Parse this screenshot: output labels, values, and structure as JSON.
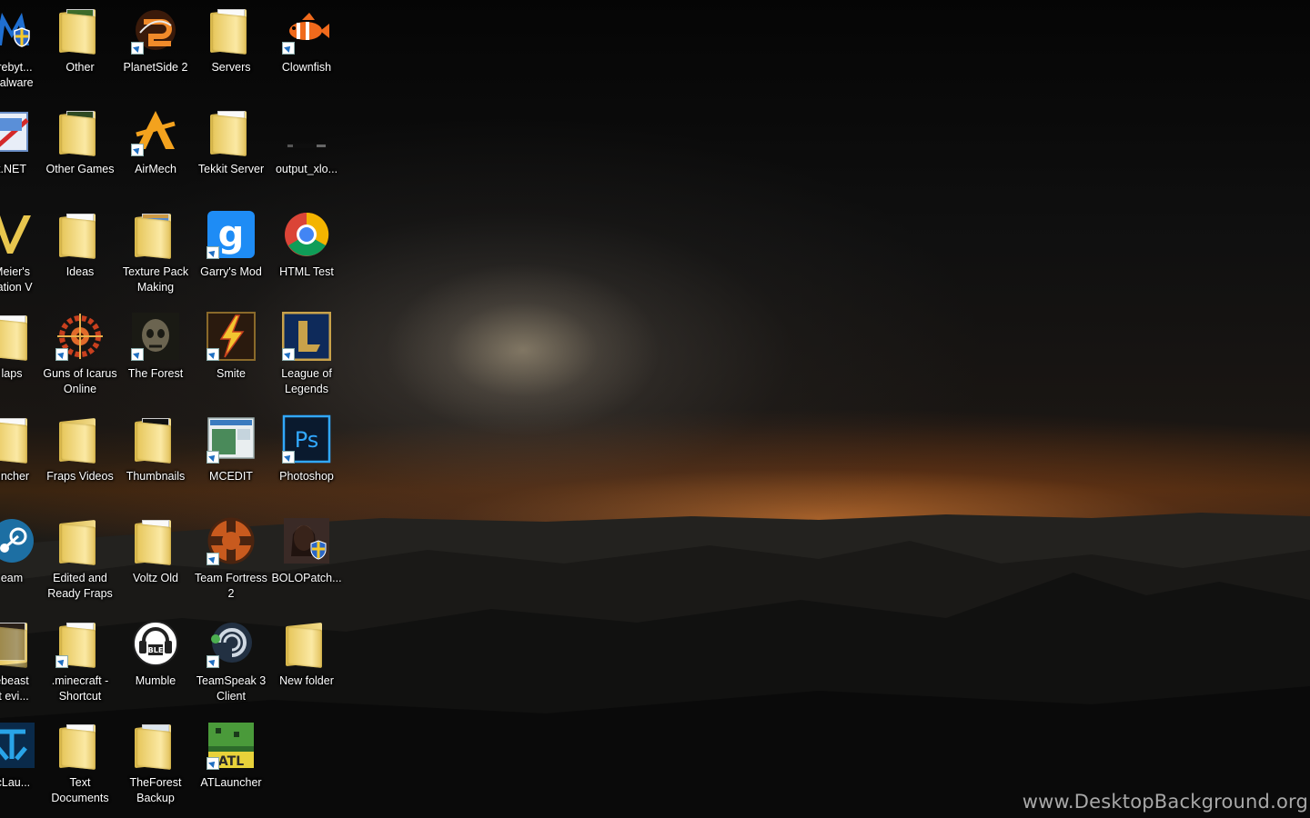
{
  "desktop": {
    "icons": [
      {
        "label": "Malwarebyt... Anti-Malware",
        "short": "arebyt...\nMalware",
        "icon": "malwarebytes-icon",
        "name": "icon-malwarebytes"
      },
      {
        "label": "Other",
        "icon": "folder-icon",
        "name": "icon-other"
      },
      {
        "label": "PlanetSide 2",
        "icon": "planetside-icon",
        "name": "icon-planetside-2"
      },
      {
        "label": "Servers",
        "icon": "folder-icon",
        "name": "icon-servers"
      },
      {
        "label": "Clownfish",
        "icon": "clownfish-icon",
        "name": "icon-clownfish"
      },
      {
        "label": "Paint.NET",
        "short": "t.NET",
        "icon": "paintnet-icon",
        "name": "icon-paintnet"
      },
      {
        "label": "Other Games",
        "icon": "folder-icon",
        "name": "icon-other-games"
      },
      {
        "label": "AirMech",
        "icon": "airmech-icon",
        "name": "icon-airmech"
      },
      {
        "label": "Tekkit Server",
        "icon": "folder-icon",
        "name": "icon-tekkit-server"
      },
      {
        "label": "output_xlo...",
        "icon": "image-file-icon",
        "name": "icon-output-xlo"
      },
      {
        "label": "Sid Meier's Civilization V",
        "short": "Meier's\nzation V",
        "icon": "civ5-icon",
        "name": "icon-civilization-v"
      },
      {
        "label": "Ideas",
        "icon": "folder-icon",
        "name": "icon-ideas"
      },
      {
        "label": "Texture Pack Making",
        "icon": "folder-icon",
        "name": "icon-texture-pack-making"
      },
      {
        "label": "Garry's Mod",
        "icon": "garrys-mod-icon",
        "name": "icon-garrys-mod"
      },
      {
        "label": "HTML Test",
        "icon": "chrome-icon",
        "name": "icon-html-test"
      },
      {
        "label": "Maps",
        "short": "laps",
        "icon": "folder-icon",
        "name": "icon-maps"
      },
      {
        "label": "Guns of Icarus Online",
        "icon": "guns-of-icarus-icon",
        "name": "icon-guns-of-icarus"
      },
      {
        "label": "The Forest",
        "icon": "the-forest-icon",
        "name": "icon-the-forest"
      },
      {
        "label": "Smite",
        "icon": "smite-icon",
        "name": "icon-smite"
      },
      {
        "label": "League of Legends",
        "icon": "league-icon",
        "name": "icon-league-of-legends"
      },
      {
        "label": "Launcher",
        "short": "uncher",
        "icon": "folder-icon",
        "name": "icon-launcher"
      },
      {
        "label": "Fraps Videos",
        "icon": "folder-icon",
        "name": "icon-fraps-videos"
      },
      {
        "label": "Thumbnails",
        "icon": "folder-icon",
        "name": "icon-thumbnails"
      },
      {
        "label": "MCEDIT",
        "icon": "mcedit-icon",
        "name": "icon-mcedit"
      },
      {
        "label": "Photoshop",
        "icon": "photoshop-icon",
        "name": "icon-photoshop"
      },
      {
        "label": "Steam",
        "short": "eam",
        "icon": "steam-icon",
        "name": "icon-steam"
      },
      {
        "label": "Edited and Ready Fraps",
        "icon": "folder-icon",
        "name": "icon-edited-ready-fraps"
      },
      {
        "label": "Voltz Old",
        "icon": "folder-icon",
        "name": "icon-voltz-old"
      },
      {
        "label": "Team Fortress 2",
        "icon": "tf2-icon",
        "name": "icon-team-fortress-2"
      },
      {
        "label": "BOLOPatch...",
        "icon": "bolopatch-icon",
        "name": "icon-bolopatch"
      },
      {
        "label": "Thebeast Short evi...",
        "short": "ebeast\nrt evi...",
        "icon": "folder-icon",
        "name": "icon-thebeast"
      },
      {
        "label": ".minecraft - Shortcut",
        "icon": "folder-icon",
        "name": "icon-minecraft-shortcut"
      },
      {
        "label": "Mumble",
        "icon": "mumble-icon",
        "name": "icon-mumble"
      },
      {
        "label": "TeamSpeak 3 Client",
        "icon": "teamspeak-icon",
        "name": "icon-teamspeak-3"
      },
      {
        "label": "New folder",
        "icon": "folder-icon",
        "name": "icon-new-folder"
      },
      {
        "label": "TechnicLauncher",
        "short": "icLau...",
        "icon": "technic-icon",
        "name": "icon-technic-launcher"
      },
      {
        "label": "Text Documents",
        "icon": "folder-icon",
        "name": "icon-text-documents"
      },
      {
        "label": "TheForest Backup",
        "icon": "folder-icon",
        "name": "icon-theforest-backup"
      },
      {
        "label": "ATLauncher",
        "icon": "atlauncher-icon",
        "name": "icon-atlauncher"
      }
    ]
  },
  "labels": {
    "r0c0": "arebyt...\nMalware",
    "r0c1": "Other",
    "r0c2": "PlanetSide 2",
    "r0c3": "Servers",
    "r0c4": "Clownfish",
    "r1c0": "t.NET",
    "r1c1": "Other Games",
    "r1c2": "AirMech",
    "r1c3": "Tekkit Server",
    "r1c4": "output_xlo...",
    "r2c0": "Meier's\nzation V",
    "r2c1": "Ideas",
    "r2c2": "Texture Pack Making",
    "r2c3": "Garry's Mod",
    "r2c4": "HTML Test",
    "r3c0": "laps",
    "r3c1": "Guns of Icarus Online",
    "r3c2": "The Forest",
    "r3c3": "Smite",
    "r3c4": "League of Legends",
    "r4c0": "uncher",
    "r4c1": "Fraps Videos",
    "r4c2": "Thumbnails",
    "r4c3": "MCEDIT",
    "r4c4": "Photoshop",
    "r5c0": "eam",
    "r5c1": "Edited and Ready Fraps",
    "r5c2": "Voltz Old",
    "r5c3": "Team Fortress 2",
    "r5c4": "BOLOPatch...",
    "r6c0": "ebeast\nrt evi...",
    "r6c1": ".minecraft - Shortcut",
    "r6c2": "Mumble",
    "r6c3": "TeamSpeak 3 Client",
    "r6c4": "New folder",
    "r7c0": "icLau...",
    "r7c1": "Text Documents",
    "r7c2": "TheForest Backup",
    "r7c3": "ATLauncher"
  },
  "watermark": "www.DesktopBackground.org",
  "colors": {
    "horizon": "#d2783a",
    "folder": "#f0d47a",
    "label_text": "#ffffff"
  }
}
